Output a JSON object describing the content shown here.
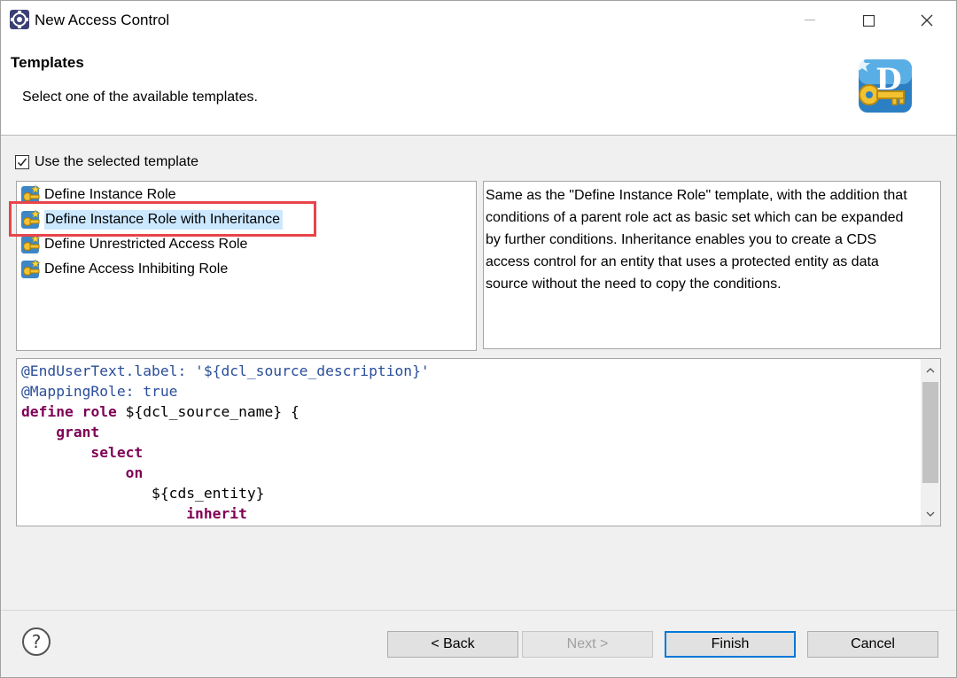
{
  "window": {
    "title": "New Access Control",
    "minimize_glyph": "—",
    "maximize_glyph": "☐",
    "close_glyph": "✕"
  },
  "banner": {
    "title": "Templates",
    "description": "Select one of the available templates.",
    "icon": "dcl-key-icon"
  },
  "use_template": {
    "label": "Use the selected template",
    "checked": true
  },
  "templates": {
    "items": [
      {
        "label": "Define Instance Role",
        "selected": false
      },
      {
        "label": "Define Instance Role with Inheritance",
        "selected": true
      },
      {
        "label": "Define Unrestricted Access Role",
        "selected": false
      },
      {
        "label": "Define Access Inhibiting Role",
        "selected": false
      }
    ]
  },
  "description": {
    "lines": [
      "Same as the \"Define Instance Role\" template, with the addition that",
      "conditions of a parent role act as basic set which can be expanded",
      "by further conditions. Inheritance enables you to create a CDS",
      "access control for an entity that uses a protected entity as data",
      "source without the need to copy the conditions."
    ]
  },
  "code_preview": {
    "lines": [
      "@EndUserText.label: '${dcl_source_description}'",
      "@MappingRole: true",
      "define role ${dcl_source_name} {",
      "    grant",
      "        select",
      "            on",
      "               ${cds_entity}",
      "                   inherit"
    ]
  },
  "buttons": {
    "back": "< Back",
    "next": "Next >",
    "finish": "Finish",
    "cancel": "Cancel"
  },
  "colors": {
    "selection": "#cce8ff",
    "highlight_border": "#e8444a",
    "keyword": "#7f0055",
    "annotation": "#2a4e99",
    "default_button_border": "#0078d7"
  }
}
